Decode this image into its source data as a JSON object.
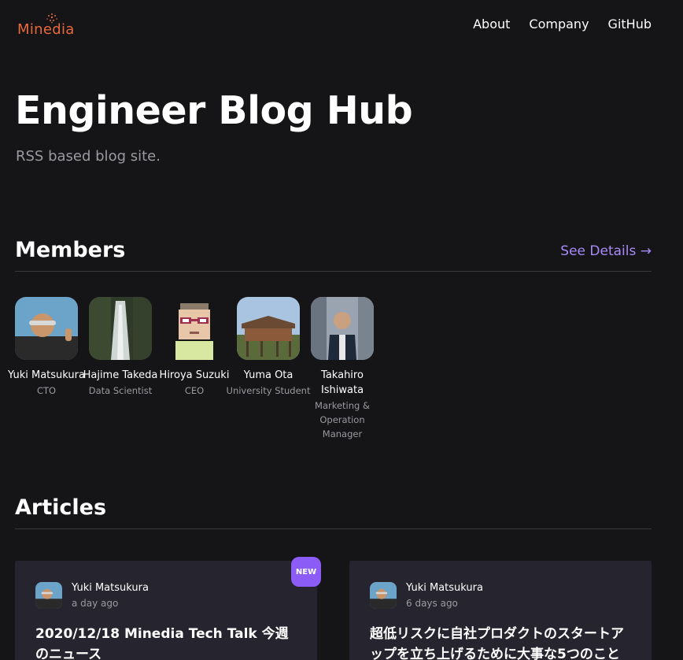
{
  "header": {
    "logo_text": "Minedia",
    "nav": [
      "About",
      "Company",
      "GitHub"
    ]
  },
  "hero": {
    "title": "Engineer Blog Hub",
    "subtitle": "RSS based blog site."
  },
  "members_section": {
    "title": "Members",
    "see_details": "See Details →",
    "members": [
      {
        "name": "Yuki Matsukura",
        "role": "CTO"
      },
      {
        "name": "Hajime Takeda",
        "role": "Data Scientist"
      },
      {
        "name": "Hiroya Suzuki",
        "role": "CEO"
      },
      {
        "name": "Yuma Ota",
        "role": "University Student"
      },
      {
        "name": "Takahiro Ishiwata",
        "role": "Marketing & Operation Manager"
      }
    ]
  },
  "articles_section": {
    "title": "Articles",
    "badge": "NEW",
    "articles": [
      {
        "author": "Yuki Matsukura",
        "date": "a day ago",
        "title": "2020/12/18 Minedia Tech Talk 今週のニュース"
      },
      {
        "author": "Yuki Matsukura",
        "date": "6 days ago",
        "title": "超低リスクに自社プロダクトのスタートアップを立ち上げるために大事な5つのこと"
      }
    ]
  },
  "colors": {
    "background": "#151416",
    "accent": "#a78bfa",
    "badge": "#8b5cf6",
    "card": "#26252f",
    "logo": "#e8693c"
  }
}
